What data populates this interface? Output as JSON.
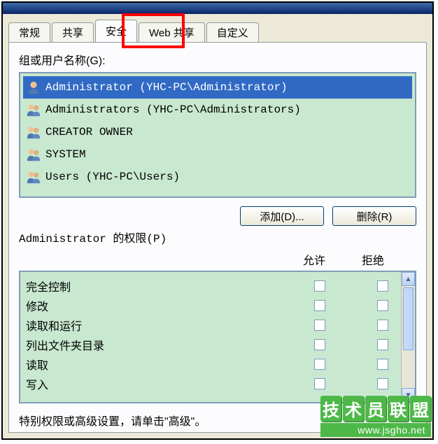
{
  "tabs": [
    {
      "label": "常规"
    },
    {
      "label": "共享"
    },
    {
      "label": "安全",
      "active": true
    },
    {
      "label": "Web 共享"
    },
    {
      "label": "自定义"
    }
  ],
  "groups_label": "组或用户名称(G):",
  "users": [
    {
      "name": "Administrator (YHC-PC\\Administrator)",
      "type": "user",
      "selected": true
    },
    {
      "name": "Administrators (YHC-PC\\Administrators)",
      "type": "group"
    },
    {
      "name": "CREATOR OWNER",
      "type": "group"
    },
    {
      "name": "SYSTEM",
      "type": "group"
    },
    {
      "name": "Users (YHC-PC\\Users)",
      "type": "group"
    }
  ],
  "buttons": {
    "add": "添加(D)...",
    "remove": "删除(R)"
  },
  "perms_label_prefix": "Administrator 的权限(P)",
  "col_allow": "允许",
  "col_deny": "拒绝",
  "permissions": [
    {
      "name": "完全控制"
    },
    {
      "name": "修改"
    },
    {
      "name": "读取和运行"
    },
    {
      "name": "列出文件夹目录"
    },
    {
      "name": "读取"
    },
    {
      "name": "写入"
    }
  ],
  "footer_text": "特别权限或高级设置，请单击\"高级\"。",
  "watermark": {
    "title": "技术员联盟",
    "url": "www.jsgho.net"
  }
}
